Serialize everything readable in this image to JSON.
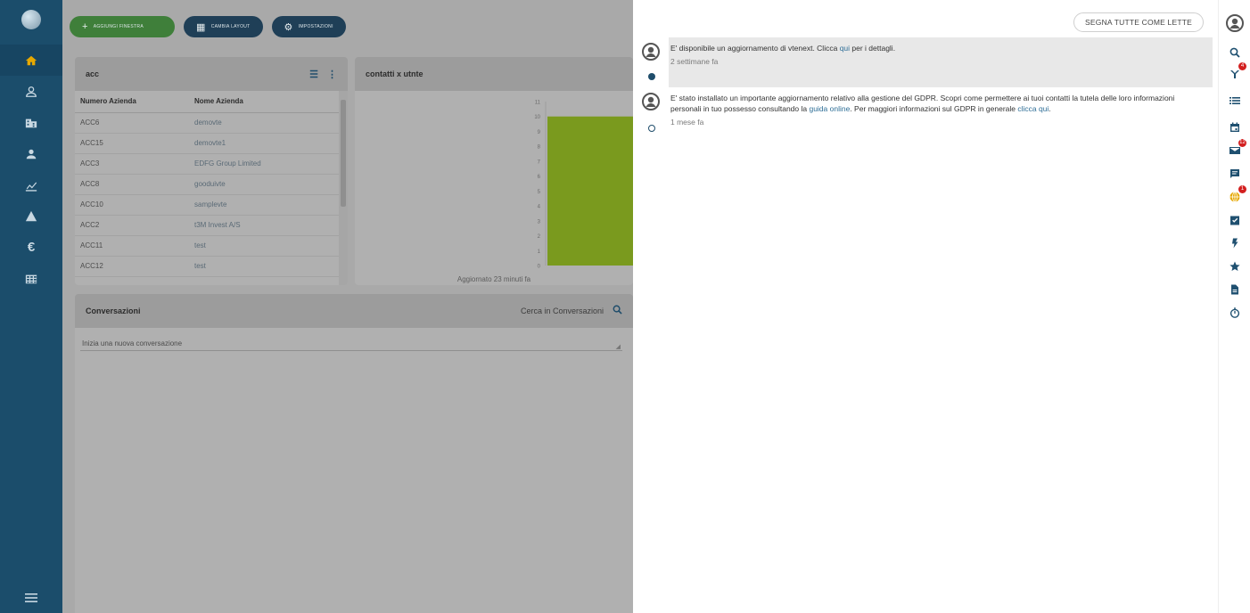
{
  "toolbar": {
    "add_window": "Aggiungi finestra",
    "change_layout": "Cambia layout",
    "settings": "Impostazioni"
  },
  "panel_acc": {
    "title": "acc",
    "columns": [
      "Numero Azienda",
      "Nome Azienda"
    ],
    "rows": [
      [
        "ACC6",
        "demovte"
      ],
      [
        "ACC15",
        "demovte1"
      ],
      [
        "ACC3",
        "EDFG Group Limited"
      ],
      [
        "ACC8",
        "gooduivte"
      ],
      [
        "ACC10",
        "samplevte"
      ],
      [
        "ACC2",
        "t3M Invest A/S"
      ],
      [
        "ACC11",
        "test"
      ],
      [
        "ACC12",
        "test"
      ]
    ]
  },
  "panel_chart": {
    "title": "contatti x utnte",
    "footer": "Aggiornato 23 minuti fa"
  },
  "chart_data": {
    "type": "bar",
    "categories": [
      ""
    ],
    "values": [
      10
    ],
    "ylim": [
      0,
      11
    ],
    "yticks": [
      0,
      1,
      2,
      3,
      4,
      5,
      6,
      7,
      8,
      9,
      10,
      11
    ],
    "color": "#7a9a1e",
    "grid": false
  },
  "panel_conv": {
    "title": "Conversazioni",
    "search_label": "Cerca in Conversazioni",
    "input_placeholder": "Inizia una nuova conversazione"
  },
  "notifications": {
    "mark_all_read": "Segna tutte come lette",
    "items": [
      {
        "text_before": "E' disponibile un aggiornamento di vtenext. Clicca ",
        "link": "qui",
        "text_after": " per i dettagli.",
        "time": "2 settimane fa",
        "unread": true
      },
      {
        "text_before": "E' stato installato un importante aggiornamento relativo alla gestione del GDPR. Scopri come permettere ai tuoi contatti la tutela delle loro informazioni personali in tuo possesso consultando la ",
        "link": "guida online",
        "text_mid": ". Per maggiori informazioni sul GDPR in generale ",
        "link2": "clicca qui",
        "text_after": ".",
        "time": "1 mese fa",
        "unread": false
      }
    ]
  },
  "rightbar": {
    "badges": {
      "activity": "4",
      "mail": "12",
      "world": "1"
    },
    "icons": [
      "search-icon",
      "activity-icon",
      "list-icon",
      "calendar-icon",
      "mail-icon",
      "chat-icon",
      "world-icon",
      "tasks-icon",
      "flash-icon",
      "star-icon",
      "document-icon",
      "timer-icon"
    ]
  },
  "leftnav": {
    "icons": [
      "home-icon",
      "contacts-icon",
      "accounts-icon",
      "user-icon",
      "chart-icon",
      "alert-icon",
      "euro-icon",
      "grid-icon"
    ],
    "active": "home-icon"
  },
  "colors": {
    "nav_bg": "#1b4d6b",
    "accent": "#e6a800",
    "bar": "#7a9a1e",
    "badge": "#d32020",
    "link": "#2f6f97"
  }
}
